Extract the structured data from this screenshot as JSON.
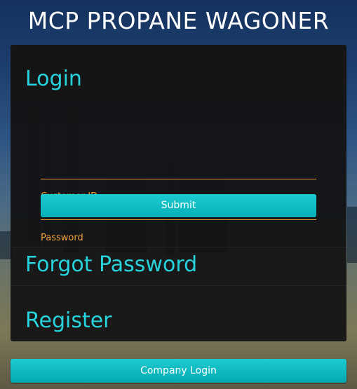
{
  "site": {
    "title": "MCP PROPANE WAGONER"
  },
  "login": {
    "heading": "Login",
    "customer_id_label": "Customer ID",
    "customer_id_value": "",
    "password_label": "Password",
    "password_value": "",
    "submit_label": "Submit"
  },
  "forgot_password": {
    "heading": "Forgot Password"
  },
  "register": {
    "heading": "Register"
  },
  "company_login": {
    "label": "Company Login"
  },
  "colors": {
    "accent": "#27d3dd",
    "field_accent": "#f2a23a",
    "button": "#05b1b8",
    "panel": "#121212"
  }
}
